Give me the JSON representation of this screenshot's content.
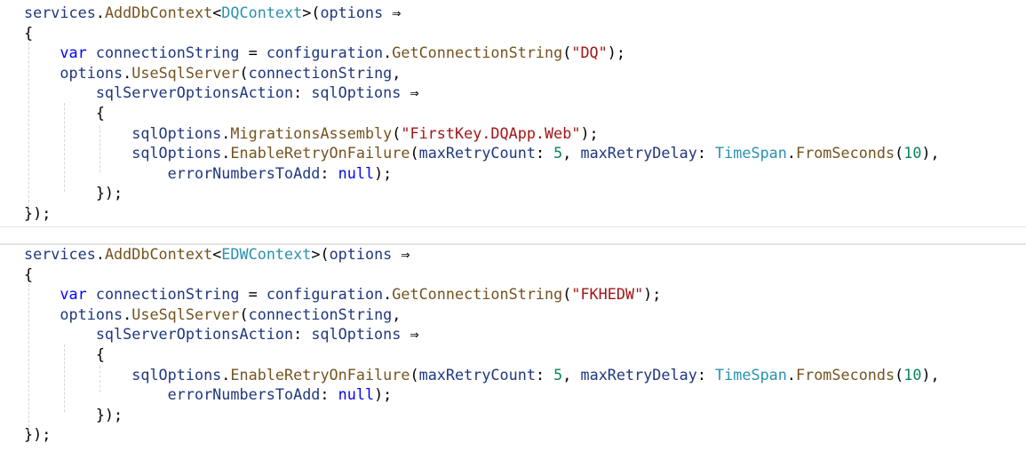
{
  "editor": {
    "blocks": [
      {
        "lines": [
          [
            {
              "t": "services",
              "c": "var"
            },
            {
              "t": ".",
              "c": "punc"
            },
            {
              "t": "AddDbContext",
              "c": "method"
            },
            {
              "t": "<",
              "c": "punc"
            },
            {
              "t": "DQContext",
              "c": "type"
            },
            {
              "t": ">(",
              "c": "punc"
            },
            {
              "t": "options",
              "c": "var"
            },
            {
              "t": " ⇒",
              "c": "punc"
            }
          ],
          [
            {
              "t": "{",
              "c": "punc"
            }
          ],
          [
            {
              "t": "    "
            },
            {
              "t": "var",
              "c": "kw"
            },
            {
              "t": " "
            },
            {
              "t": "connectionString",
              "c": "var"
            },
            {
              "t": " = ",
              "c": "punc"
            },
            {
              "t": "configuration",
              "c": "var"
            },
            {
              "t": ".",
              "c": "punc"
            },
            {
              "t": "GetConnectionString",
              "c": "method"
            },
            {
              "t": "(",
              "c": "punc"
            },
            {
              "t": "\"DQ\"",
              "c": "str"
            },
            {
              "t": ");",
              "c": "punc"
            }
          ],
          [
            {
              "t": "    "
            },
            {
              "t": "options",
              "c": "var"
            },
            {
              "t": ".",
              "c": "punc"
            },
            {
              "t": "UseSqlServer",
              "c": "method"
            },
            {
              "t": "(",
              "c": "punc"
            },
            {
              "t": "connectionString",
              "c": "var"
            },
            {
              "t": ",",
              "c": "punc"
            }
          ],
          [
            {
              "t": "        "
            },
            {
              "t": "sqlServerOptionsAction",
              "c": "var"
            },
            {
              "t": ": ",
              "c": "punc"
            },
            {
              "t": "sqlOptions",
              "c": "var"
            },
            {
              "t": " ⇒",
              "c": "punc"
            }
          ],
          [
            {
              "t": "        "
            },
            {
              "t": "{",
              "c": "punc"
            }
          ],
          [
            {
              "t": "            "
            },
            {
              "t": "sqlOptions",
              "c": "var"
            },
            {
              "t": ".",
              "c": "punc"
            },
            {
              "t": "MigrationsAssembly",
              "c": "method"
            },
            {
              "t": "(",
              "c": "punc"
            },
            {
              "t": "\"FirstKey.DQApp.Web\"",
              "c": "str"
            },
            {
              "t": ");",
              "c": "punc"
            }
          ],
          [
            {
              "t": "            "
            },
            {
              "t": "sqlOptions",
              "c": "var"
            },
            {
              "t": ".",
              "c": "punc"
            },
            {
              "t": "EnableRetryOnFailure",
              "c": "method"
            },
            {
              "t": "(",
              "c": "punc"
            },
            {
              "t": "maxRetryCount",
              "c": "var"
            },
            {
              "t": ": ",
              "c": "punc"
            },
            {
              "t": "5",
              "c": "num"
            },
            {
              "t": ", ",
              "c": "punc"
            },
            {
              "t": "maxRetryDelay",
              "c": "var"
            },
            {
              "t": ": ",
              "c": "punc"
            },
            {
              "t": "TimeSpan",
              "c": "type"
            },
            {
              "t": ".",
              "c": "punc"
            },
            {
              "t": "FromSeconds",
              "c": "method"
            },
            {
              "t": "(",
              "c": "punc"
            },
            {
              "t": "10",
              "c": "num"
            },
            {
              "t": "),",
              "c": "punc"
            }
          ],
          [
            {
              "t": "                "
            },
            {
              "t": "errorNumbersToAdd",
              "c": "var"
            },
            {
              "t": ": ",
              "c": "punc"
            },
            {
              "t": "null",
              "c": "kw"
            },
            {
              "t": ");",
              "c": "punc"
            }
          ],
          [
            {
              "t": "        "
            },
            {
              "t": "});",
              "c": "punc"
            }
          ],
          [
            {
              "t": "});",
              "c": "punc"
            }
          ]
        ]
      },
      {
        "lines": [
          [
            {
              "t": "services",
              "c": "var"
            },
            {
              "t": ".",
              "c": "punc"
            },
            {
              "t": "AddDbContext",
              "c": "method"
            },
            {
              "t": "<",
              "c": "punc"
            },
            {
              "t": "EDWContext",
              "c": "type"
            },
            {
              "t": ">(",
              "c": "punc"
            },
            {
              "t": "options",
              "c": "var"
            },
            {
              "t": " ⇒",
              "c": "punc"
            }
          ],
          [
            {
              "t": "{",
              "c": "punc"
            }
          ],
          [
            {
              "t": "    "
            },
            {
              "t": "var",
              "c": "kw"
            },
            {
              "t": " "
            },
            {
              "t": "connectionString",
              "c": "var"
            },
            {
              "t": " = ",
              "c": "punc"
            },
            {
              "t": "configuration",
              "c": "var"
            },
            {
              "t": ".",
              "c": "punc"
            },
            {
              "t": "GetConnectionString",
              "c": "method"
            },
            {
              "t": "(",
              "c": "punc"
            },
            {
              "t": "\"FKHEDW\"",
              "c": "str"
            },
            {
              "t": ");",
              "c": "punc"
            }
          ],
          [
            {
              "t": "    "
            },
            {
              "t": "options",
              "c": "var"
            },
            {
              "t": ".",
              "c": "punc"
            },
            {
              "t": "UseSqlServer",
              "c": "method"
            },
            {
              "t": "(",
              "c": "punc"
            },
            {
              "t": "connectionString",
              "c": "var"
            },
            {
              "t": ",",
              "c": "punc"
            }
          ],
          [
            {
              "t": "        "
            },
            {
              "t": "sqlServerOptionsAction",
              "c": "var"
            },
            {
              "t": ": ",
              "c": "punc"
            },
            {
              "t": "sqlOptions",
              "c": "var"
            },
            {
              "t": " ⇒",
              "c": "punc"
            }
          ],
          [
            {
              "t": "        "
            },
            {
              "t": "{",
              "c": "punc"
            }
          ],
          [
            {
              "t": "            "
            },
            {
              "t": "sqlOptions",
              "c": "var"
            },
            {
              "t": ".",
              "c": "punc"
            },
            {
              "t": "EnableRetryOnFailure",
              "c": "method"
            },
            {
              "t": "(",
              "c": "punc"
            },
            {
              "t": "maxRetryCount",
              "c": "var"
            },
            {
              "t": ": ",
              "c": "punc"
            },
            {
              "t": "5",
              "c": "num"
            },
            {
              "t": ", ",
              "c": "punc"
            },
            {
              "t": "maxRetryDelay",
              "c": "var"
            },
            {
              "t": ": ",
              "c": "punc"
            },
            {
              "t": "TimeSpan",
              "c": "type"
            },
            {
              "t": ".",
              "c": "punc"
            },
            {
              "t": "FromSeconds",
              "c": "method"
            },
            {
              "t": "(",
              "c": "punc"
            },
            {
              "t": "10",
              "c": "num"
            },
            {
              "t": "),",
              "c": "punc"
            }
          ],
          [
            {
              "t": "                "
            },
            {
              "t": "errorNumbersToAdd",
              "c": "var"
            },
            {
              "t": ": ",
              "c": "punc"
            },
            {
              "t": "null",
              "c": "kw"
            },
            {
              "t": ");",
              "c": "punc"
            }
          ],
          [
            {
              "t": "        "
            },
            {
              "t": "});",
              "c": "punc"
            }
          ],
          [
            {
              "t": "});",
              "c": "punc"
            }
          ]
        ]
      }
    ]
  }
}
